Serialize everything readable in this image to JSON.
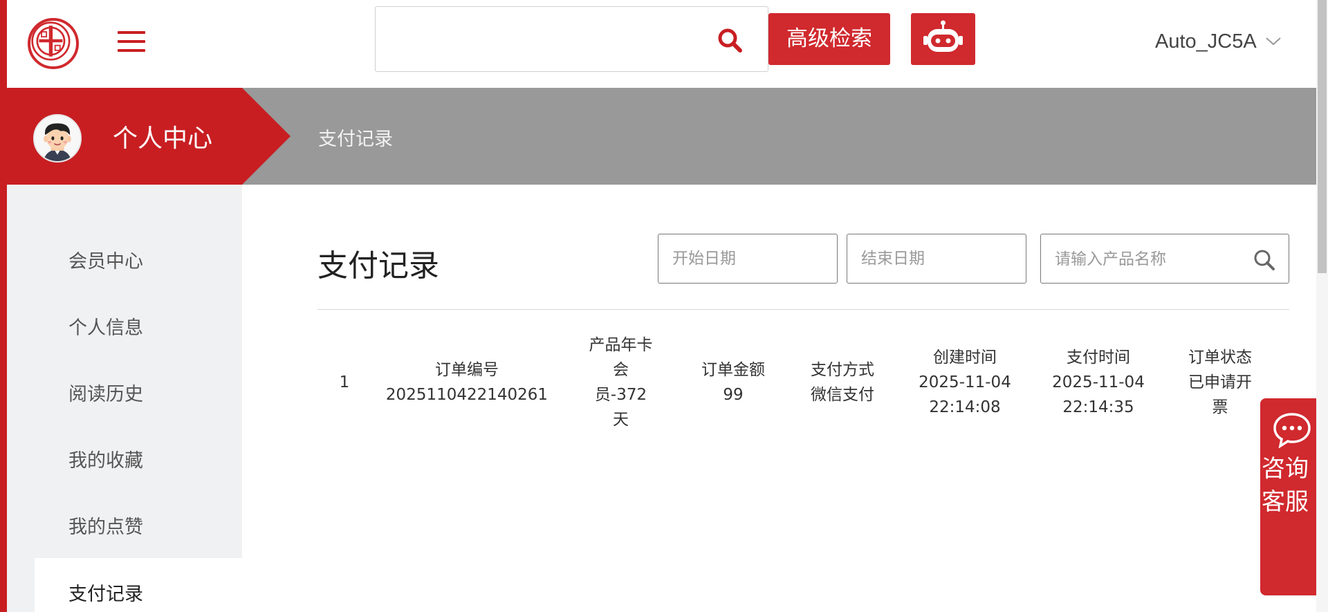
{
  "header": {
    "search_placeholder": "",
    "advanced_search_label": "高级检索",
    "username": "Auto_JC5A"
  },
  "banner": {
    "title": "个人中心",
    "breadcrumb": "支付记录"
  },
  "sidebar": {
    "items": [
      {
        "label": "会员中心"
      },
      {
        "label": "个人信息"
      },
      {
        "label": "阅读历史"
      },
      {
        "label": "我的收藏"
      },
      {
        "label": "我的点赞"
      },
      {
        "label": "支付记录",
        "active": true
      }
    ]
  },
  "main": {
    "title": "支付记录",
    "start_date_placeholder": "开始日期",
    "end_date_placeholder": "结束日期",
    "product_search_placeholder": "请输入产品名称"
  },
  "record": {
    "index": "1",
    "order_no_label": "订单编号",
    "order_no": "2025110422140261",
    "product_lines": [
      "产品年卡",
      "会",
      "员-372",
      "天"
    ],
    "amount_label": "订单金额",
    "amount": "99",
    "pay_method_label": "支付方式",
    "pay_method": "微信支付",
    "created_label": "创建时间",
    "created_date": "2025-11-04",
    "created_time": "22:14:08",
    "paid_label": "支付时间",
    "paid_date": "2025-11-04",
    "paid_time": "22:14:35",
    "status_lines": [
      "订单状态",
      "已申请开",
      "票"
    ]
  },
  "consult": {
    "label": "咨询客服"
  },
  "colors": {
    "brand_red": "#c81e22",
    "banner_gray": "#999999",
    "sidebar_bg": "#f0f1f3"
  }
}
